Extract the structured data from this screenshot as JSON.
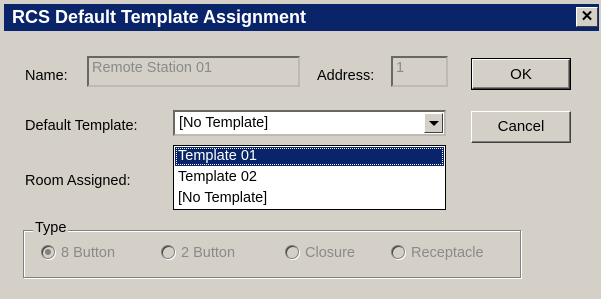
{
  "window": {
    "title": "RCS Default Template Assignment",
    "close_glyph": "✕"
  },
  "form": {
    "name_label": "Name:",
    "name_value": "Remote Station 01",
    "address_label": "Address:",
    "address_value": "1",
    "default_template_label": "Default Template:",
    "default_template_value": "[No Template]",
    "room_assigned_label": "Room Assigned:"
  },
  "buttons": {
    "ok": "OK",
    "cancel": "Cancel"
  },
  "dropdown": {
    "options": [
      "Template 01",
      "Template 02",
      "[No Template]"
    ],
    "highlighted": "Template 01"
  },
  "type_group": {
    "title": "Type",
    "options": [
      {
        "label": "8 Button",
        "checked": true
      },
      {
        "label": "2 Button",
        "checked": false
      },
      {
        "label": "Closure",
        "checked": false
      },
      {
        "label": "Receptacle",
        "checked": false
      }
    ]
  }
}
